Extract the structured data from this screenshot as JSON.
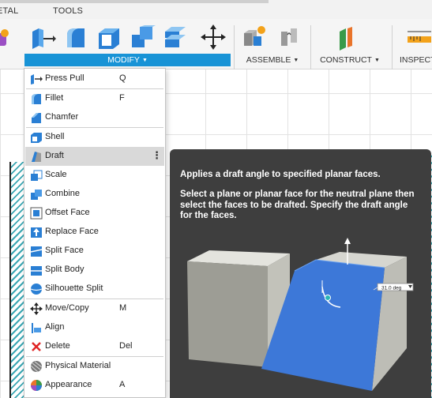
{
  "ribbon": {
    "tabs": [
      "ETAL",
      "TOOLS"
    ],
    "groups": {
      "modify": "MODIFY",
      "assemble": "ASSEMBLE",
      "construct": "CONSTRUCT",
      "inspect": "INSPECT"
    }
  },
  "colors": {
    "accent": "#1893d6",
    "menu_highlight": "#d9d9d9",
    "tooltip_bg": "#3e3e3e",
    "draft_face": "#3d78d8"
  },
  "modify_menu": {
    "items": [
      {
        "label": "Press Pull",
        "shortcut": "Q",
        "icon": "press-pull-icon"
      },
      {
        "label": "Fillet",
        "shortcut": "F",
        "icon": "fillet-icon"
      },
      {
        "label": "Chamfer",
        "shortcut": "",
        "icon": "chamfer-icon"
      },
      {
        "label": "Shell",
        "shortcut": "",
        "icon": "shell-icon"
      },
      {
        "label": "Draft",
        "shortcut": "",
        "icon": "draft-icon",
        "highlighted": true
      },
      {
        "label": "Scale",
        "shortcut": "",
        "icon": "scale-icon"
      },
      {
        "label": "Combine",
        "shortcut": "",
        "icon": "combine-icon"
      },
      {
        "label": "Offset Face",
        "shortcut": "",
        "icon": "offset-face-icon"
      },
      {
        "label": "Replace Face",
        "shortcut": "",
        "icon": "replace-face-icon"
      },
      {
        "label": "Split Face",
        "shortcut": "",
        "icon": "split-face-icon"
      },
      {
        "label": "Split Body",
        "shortcut": "",
        "icon": "split-body-icon"
      },
      {
        "label": "Silhouette Split",
        "shortcut": "",
        "icon": "silhouette-split-icon"
      },
      {
        "label": "Move/Copy",
        "shortcut": "M",
        "icon": "move-copy-icon"
      },
      {
        "label": "Align",
        "shortcut": "",
        "icon": "align-icon"
      },
      {
        "label": "Delete",
        "shortcut": "Del",
        "icon": "delete-icon"
      },
      {
        "label": "Physical Material",
        "shortcut": "",
        "icon": "physical-material-icon"
      },
      {
        "label": "Appearance",
        "shortcut": "A",
        "icon": "appearance-icon"
      }
    ]
  },
  "tooltip": {
    "title": "Applies a draft angle to specified planar faces.",
    "body": "Select a plane or planar face for the neutral plane then select the faces to be drafted. Specify the draft angle for the faces.",
    "dimension_value": "31.0 deg"
  }
}
